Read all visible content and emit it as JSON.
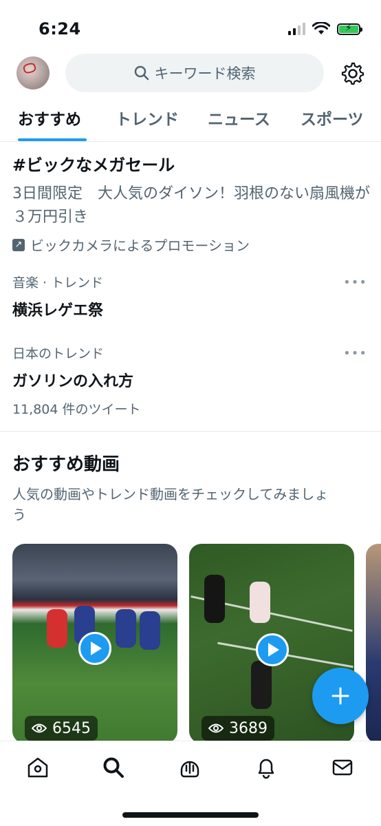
{
  "status_bar": {
    "time": "6:24"
  },
  "header": {
    "search_placeholder": "キーワード検索"
  },
  "tabs": [
    {
      "label": "おすすめ",
      "active": true
    },
    {
      "label": "トレンド",
      "active": false
    },
    {
      "label": "ニュース",
      "active": false
    },
    {
      "label": "スポーツ",
      "active": false
    }
  ],
  "promo": {
    "title": "#ビックなメガセール",
    "description": "3日間限定　大人気のダイソン！羽根のない扇風機が３万円引き",
    "promoted_by": "ビックカメラによるプロモーション"
  },
  "trends": [
    {
      "category": "音楽 · トレンド",
      "name": "横浜レゲエ祭",
      "count": ""
    },
    {
      "category": "日本のトレンド",
      "name": "ガソリンの入れ方",
      "count": "11,804 件のツイート"
    }
  ],
  "videos_section": {
    "title": "おすすめ動画",
    "description": "人気の動画やトレンド動画をチェックしてみましょう",
    "videos": [
      {
        "views": "6545"
      },
      {
        "views": "3689"
      }
    ]
  },
  "fab": {
    "icon": "plus-icon"
  },
  "bottom_nav": [
    "home-icon",
    "search-icon",
    "spaces-icon",
    "notifications-icon",
    "messages-icon"
  ],
  "colors": {
    "accent": "#1d9bf0",
    "text": "#0f1419",
    "secondary": "#536471"
  }
}
